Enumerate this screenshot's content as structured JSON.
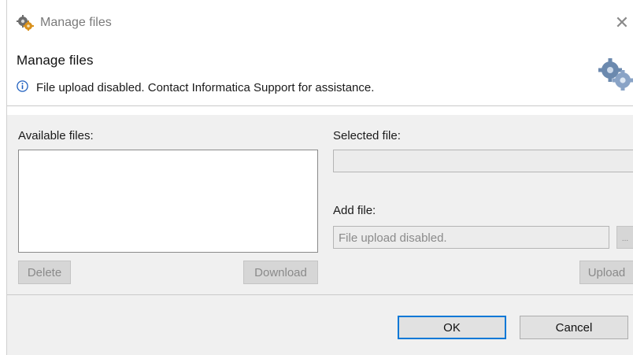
{
  "window": {
    "title": "Manage files",
    "title_icon": "gears-icon",
    "close_glyph": "✕"
  },
  "banner": {
    "title": "Manage files",
    "message": "File upload disabled. Contact Informatica Support for assistance.",
    "info_icon": "info-icon",
    "decor_icon": "gears-icon"
  },
  "available_files": {
    "label": "Available files:",
    "items": [],
    "delete_label": "Delete",
    "download_label": "Download"
  },
  "selected_file": {
    "label": "Selected file:",
    "value": ""
  },
  "add_file": {
    "label": "Add file:",
    "placeholder": "File upload disabled.",
    "browse_label": "...",
    "upload_label": "Upload"
  },
  "footer": {
    "ok_label": "OK",
    "cancel_label": "Cancel"
  },
  "colors": {
    "accent": "#0078d7",
    "info": "#1f5fbf",
    "panel": "#f0f0f0"
  }
}
